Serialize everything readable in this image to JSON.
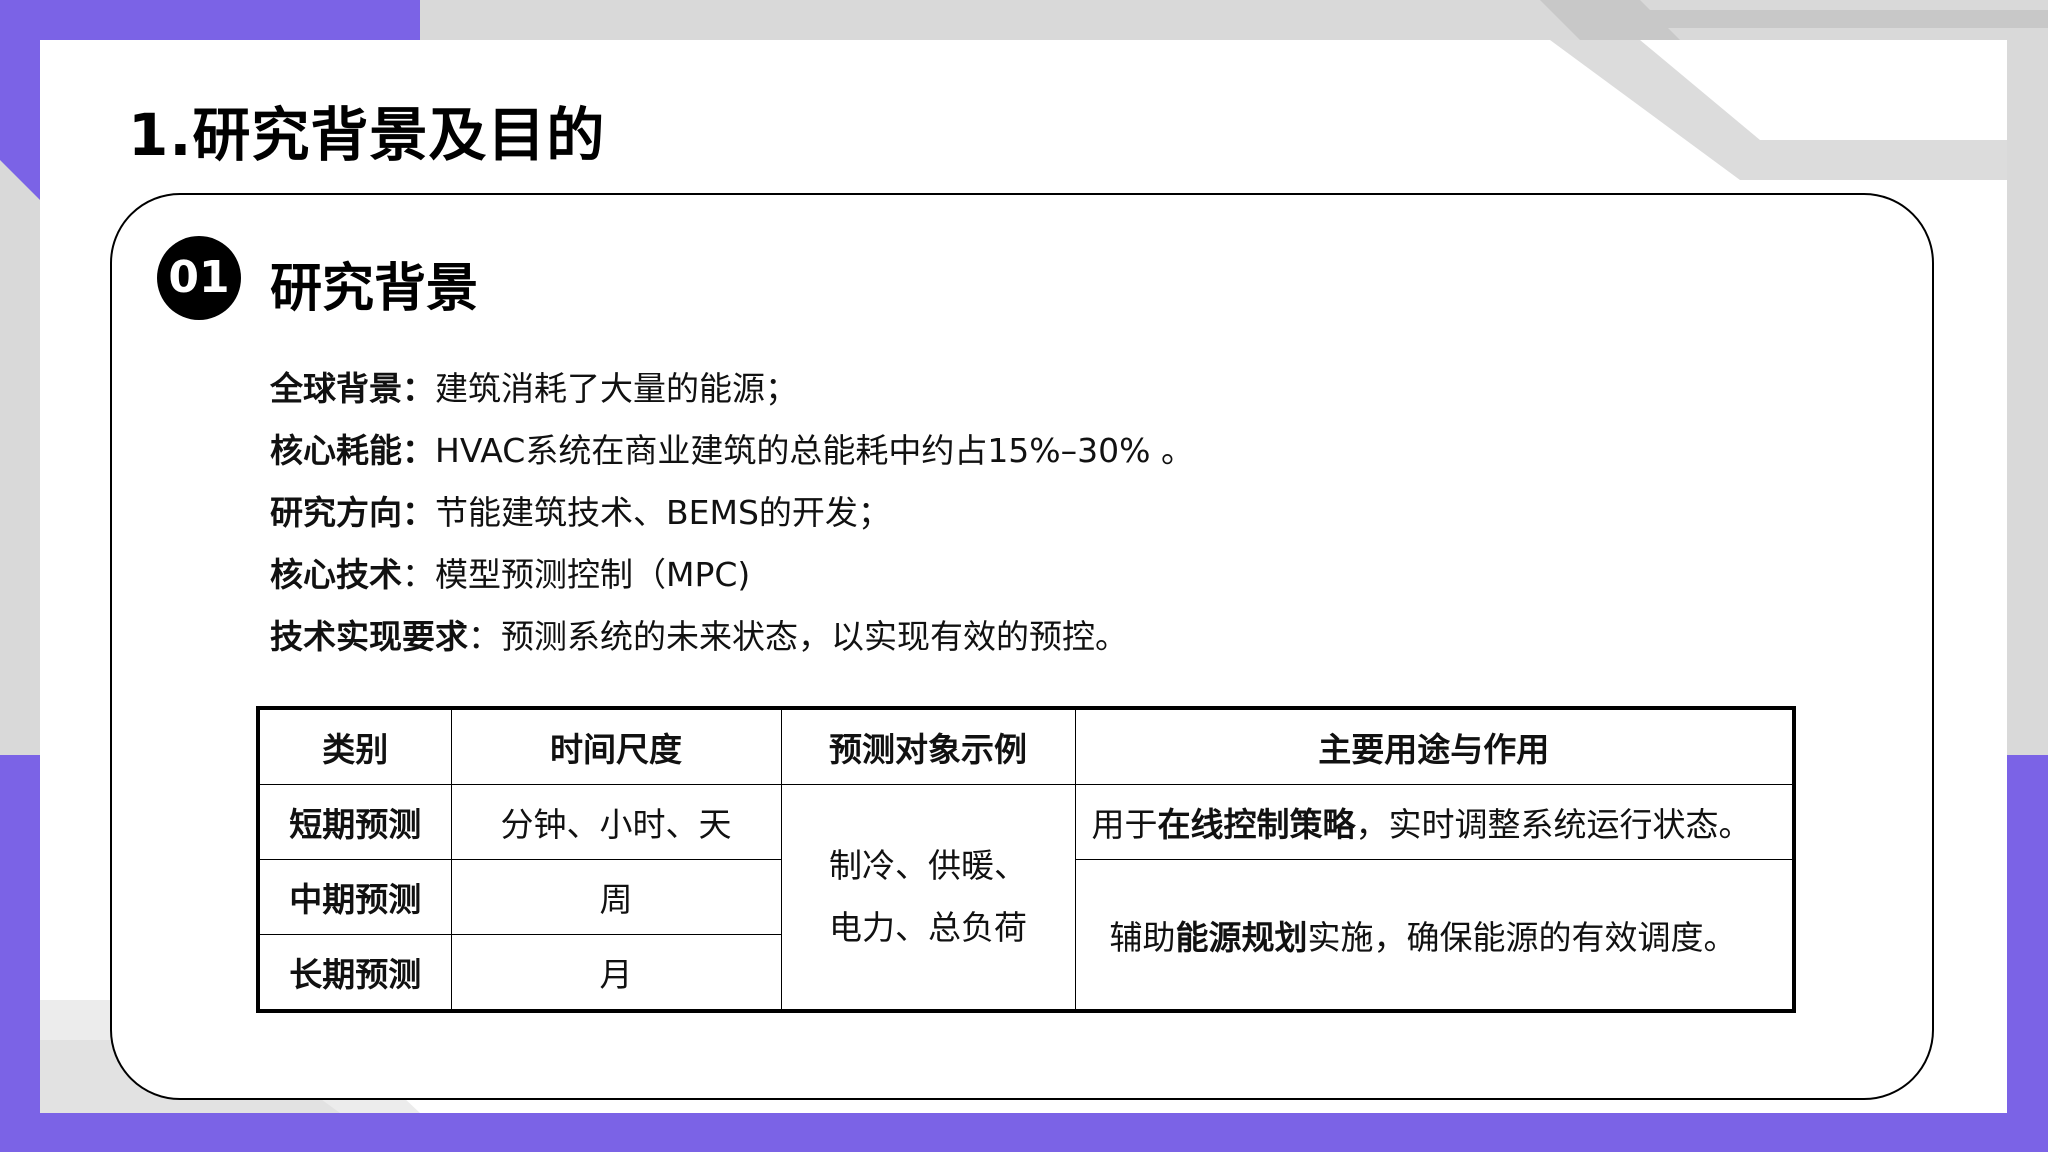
{
  "colors": {
    "accent": "#7b63e6",
    "gray_stripe": "#d9d9d9",
    "text": "#111111"
  },
  "page_title": "1.研究背景及目的",
  "section": {
    "number": "01",
    "title": "研究背景"
  },
  "bullets": [
    {
      "key": "全球背景：",
      "text": "建筑消耗了大量的能源；"
    },
    {
      "key": "核心耗能：",
      "text": "HVAC系统在商业建筑的总能耗中约占15%–30% 。"
    },
    {
      "key": "研究方向：",
      "text": "节能建筑技术、BEMS的开发；"
    },
    {
      "key": "核心技术",
      "text": "：模型预测控制（MPC)"
    },
    {
      "key": "技术实现要求",
      "text": "：预测系统的未来状态，以实现有效的预控。"
    }
  ],
  "table": {
    "headers": [
      "类别",
      "时间尺度",
      "预测对象示例",
      "主要用途与作用"
    ],
    "categories": [
      "短期预测",
      "中期预测",
      "长期预测"
    ],
    "timescales": [
      "分钟、小时、天",
      "周",
      "月"
    ],
    "targets_line1": "制冷、供暖、",
    "targets_line2": "电力、总负荷",
    "usage_short": {
      "pre": "用于",
      "bold": "在线控制策略",
      "post": "，实时调整系统运行状态。"
    },
    "usage_long": {
      "pre": "辅助",
      "bold": "能源规划",
      "post": "实施，确保能源的有效调度。"
    }
  }
}
